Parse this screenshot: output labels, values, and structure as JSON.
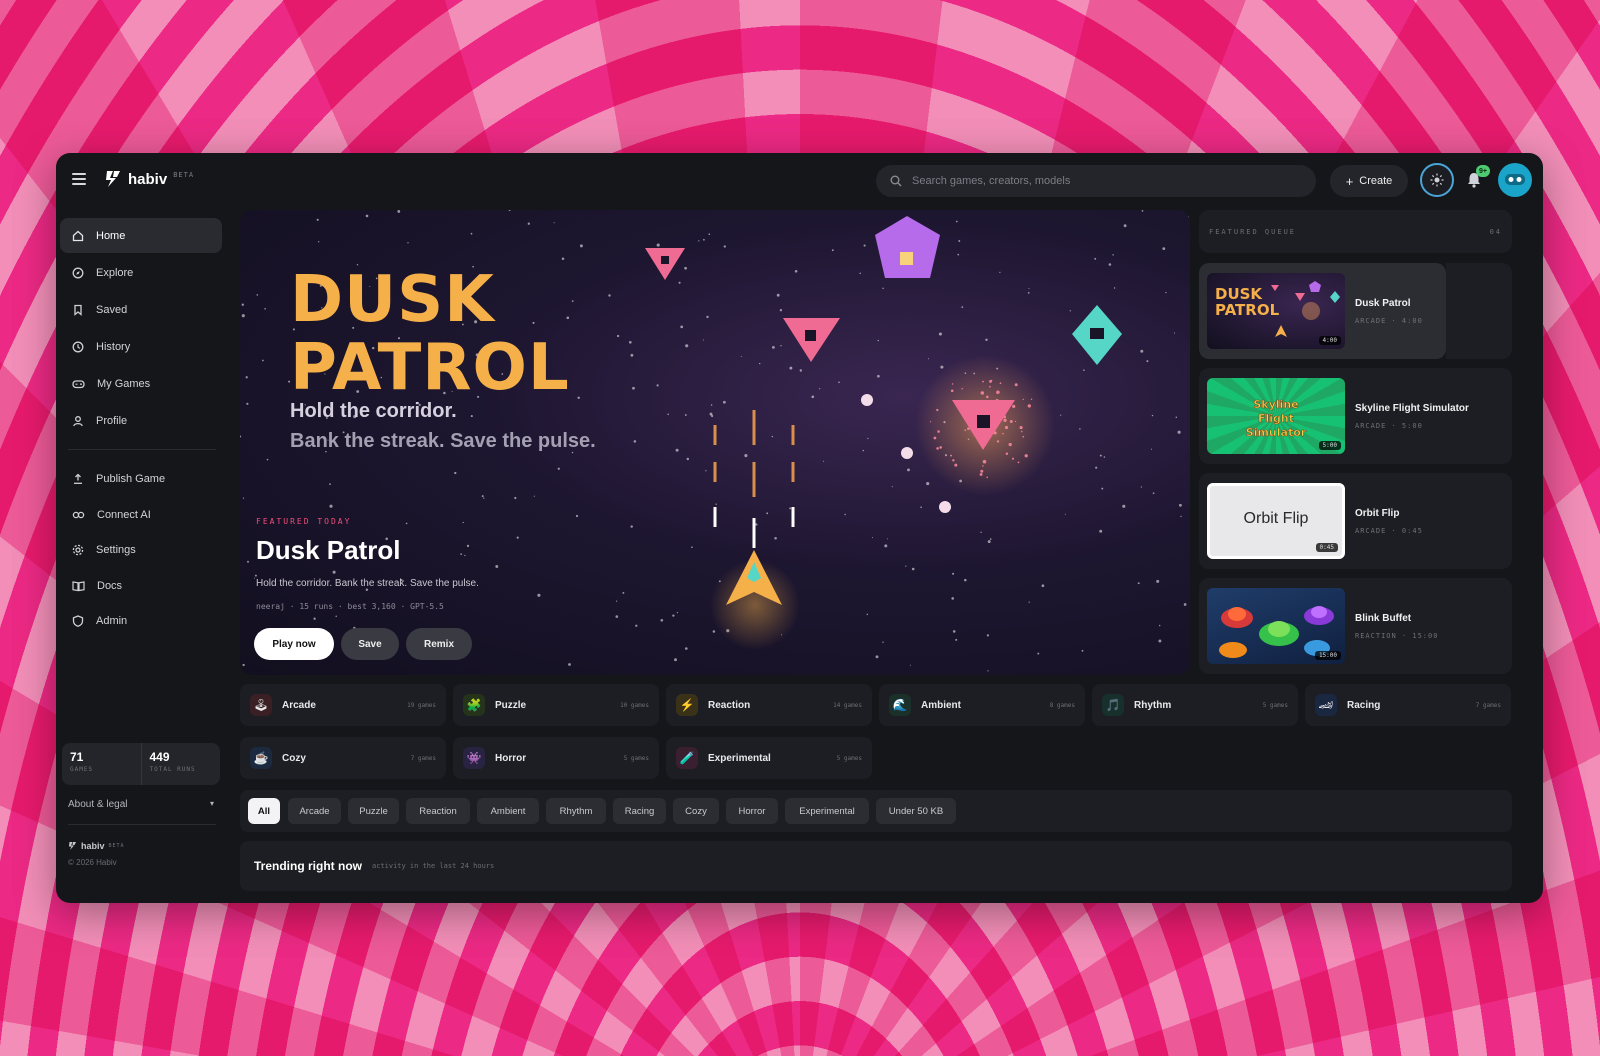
{
  "app": {
    "name": "habiv",
    "badge": "BETA"
  },
  "search": {
    "placeholder": "Search games, creators, models"
  },
  "topbar": {
    "create_label": "Create",
    "notification_count": "9+"
  },
  "sidebar": {
    "items": [
      {
        "label": "Home",
        "icon": "home-icon",
        "active": true
      },
      {
        "label": "Explore",
        "icon": "compass-icon"
      },
      {
        "label": "Saved",
        "icon": "bookmark-icon"
      },
      {
        "label": "History",
        "icon": "history-icon"
      },
      {
        "label": "My Games",
        "icon": "gamepad-icon"
      },
      {
        "label": "Profile",
        "icon": "user-icon"
      }
    ],
    "items2": [
      {
        "label": "Publish Game",
        "icon": "upload-icon"
      },
      {
        "label": "Connect AI",
        "icon": "link-icon"
      },
      {
        "label": "Settings",
        "icon": "gear-icon"
      },
      {
        "label": "Docs",
        "icon": "book-icon"
      },
      {
        "label": "Admin",
        "icon": "shield-icon"
      }
    ],
    "stats": [
      {
        "value": "71",
        "label": "GAMES"
      },
      {
        "value": "449",
        "label": "TOTAL RUNS"
      }
    ],
    "about_label": "About & legal",
    "footer_brand": "habiv",
    "footer_badge": "BETA",
    "copyright": "© 2026 Habiv"
  },
  "hero": {
    "title_line1": "DUSK",
    "title_line2": "PATROL",
    "tagline1": "Hold the corridor.",
    "tagline2": "Bank the streak. Save the pulse.",
    "featured_label": "FEATURED TODAY",
    "game_title": "Dusk Patrol",
    "description": "Hold the corridor. Bank the streak. Save the pulse.",
    "meta": "neeraj · 15 runs · best 3,160 · GPT-5.5",
    "play_label": "Play now",
    "save_label": "Save",
    "remix_label": "Remix"
  },
  "queue": {
    "header": "FEATURED QUEUE",
    "count": "04",
    "items": [
      {
        "name": "Dusk Patrol",
        "meta": "ARCADE · 4:00",
        "duration": "4:00",
        "thumb": "dusk"
      },
      {
        "name": "Skyline Flight Simulator",
        "meta": "ARCADE · 5:00",
        "duration": "5:00",
        "thumb": "skyline"
      },
      {
        "name": "Orbit Flip",
        "meta": "ARCADE · 0:45",
        "duration": "0:45",
        "thumb": "orbit",
        "thumb_text": "Orbit Flip"
      },
      {
        "name": "Blink Buffet",
        "meta": "REACTION · 15:00",
        "duration": "15:00",
        "thumb": "blink"
      }
    ]
  },
  "categories": [
    {
      "name": "Arcade",
      "count": "19 games",
      "color": "#c9414b",
      "glyph": "🕹"
    },
    {
      "name": "Puzzle",
      "count": "10 games",
      "color": "#7dbf3b",
      "glyph": "🧩"
    },
    {
      "name": "Reaction",
      "count": "14 games",
      "color": "#e0b52d",
      "glyph": "⚡"
    },
    {
      "name": "Ambient",
      "count": "8 games",
      "color": "#2e8b6a",
      "glyph": "🌊"
    },
    {
      "name": "Rhythm",
      "count": "5 games",
      "color": "#1f8a7a",
      "glyph": "🎵"
    },
    {
      "name": "Racing",
      "count": "7 games",
      "color": "#2c5fa8",
      "glyph": "🏎"
    },
    {
      "name": "Cozy",
      "count": "7 games",
      "color": "#3b6fb0",
      "glyph": "☕"
    },
    {
      "name": "Horror",
      "count": "5 games",
      "color": "#6c5aa8",
      "glyph": "👾"
    },
    {
      "name": "Experimental",
      "count": "5 games",
      "color": "#b0487f",
      "glyph": "🧪"
    }
  ],
  "filters": [
    "All",
    "Arcade",
    "Puzzle",
    "Reaction",
    "Ambient",
    "Rhythm",
    "Racing",
    "Cozy",
    "Horror",
    "Experimental",
    "Under 50 KB"
  ],
  "trending": {
    "title": "Trending right now",
    "subtitle": "activity in the last 24 hours"
  },
  "colors": {
    "accent_gold": "#f5b04a",
    "accent_pink": "#ef4f7b",
    "background": "#15161a"
  }
}
